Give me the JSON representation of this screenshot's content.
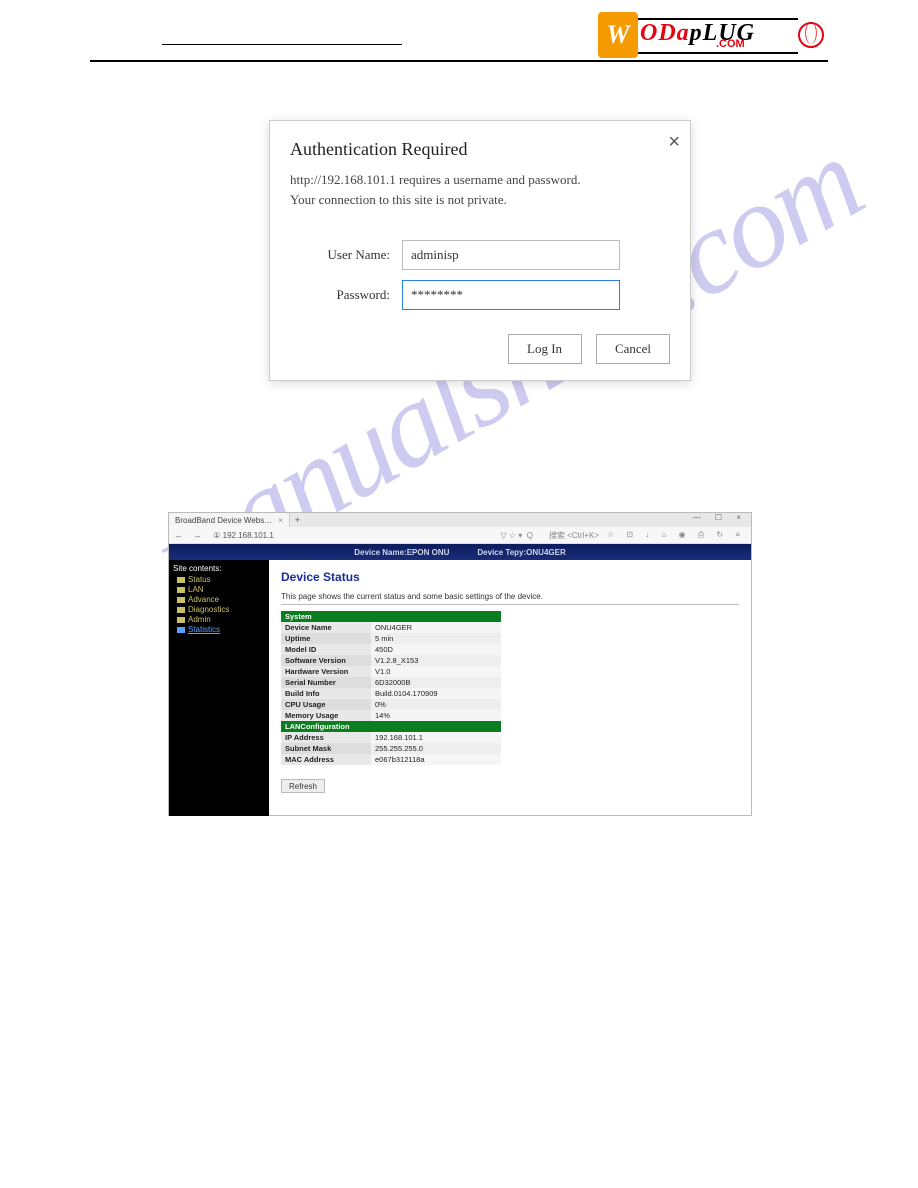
{
  "logo": {
    "letter": "W",
    "text_dark": "ODa",
    "text_red": "pLUG",
    "sub": ".COM"
  },
  "watermark": "manualshive.com",
  "auth": {
    "title": "Authentication Required",
    "line1": "http://192.168.101.1 requires a username and password.",
    "line2": "Your connection to this site is not private.",
    "user_label": "User Name:",
    "user_value": "adminisp",
    "pass_label": "Password:",
    "pass_value": "********",
    "login_btn": "Log In",
    "cancel_btn": "Cancel"
  },
  "browser": {
    "tab_title": "BroadBand Device Webs…",
    "url_prefix": "①",
    "url": "192.168.101.1",
    "search_hint": "搜索 <Ctrl+K>",
    "banner_left": "Device Name:EPON ONU",
    "banner_right": "Device Tepy:ONU4GER",
    "sidebar": {
      "header": "Site contents:",
      "items": [
        "Status",
        "LAN",
        "Advance",
        "Diagnostics",
        "Admin",
        "Statistics"
      ]
    },
    "page": {
      "title": "Device Status",
      "desc": "This page shows the current status and some basic settings of the device.",
      "groups": [
        {
          "header": "System",
          "rows": [
            {
              "k": "Device Name",
              "v": "ONU4GER"
            },
            {
              "k": "Uptime",
              "v": "5 min"
            },
            {
              "k": "Model ID",
              "v": "450D"
            },
            {
              "k": "Software Version",
              "v": "V1.2.8_X153"
            },
            {
              "k": "Hardware Version",
              "v": "V1.0"
            },
            {
              "k": "Serial Number",
              "v": "6D32000B"
            },
            {
              "k": "Build Info",
              "v": "Build.0104.170909"
            },
            {
              "k": "CPU Usage",
              "v": "0%"
            },
            {
              "k": "Memory Usage",
              "v": "14%"
            }
          ]
        },
        {
          "header": "LANConfiguration",
          "rows": [
            {
              "k": "IP Address",
              "v": "192.168.101.1"
            },
            {
              "k": "Subnet Mask",
              "v": "255.255.255.0"
            },
            {
              "k": "MAC Address",
              "v": "e067b312118a"
            }
          ]
        }
      ],
      "refresh": "Refresh"
    }
  }
}
